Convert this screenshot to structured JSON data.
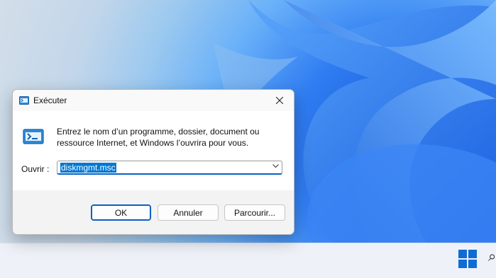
{
  "dialog": {
    "title": "Exécuter",
    "description": "Entrez le nom d’un programme, dossier, document ou ressource Internet, et Windows l’ouvrira pour vous.",
    "open_label": "Ouvrir :",
    "open_value": "diskmgmt.msc",
    "ok_label": "OK",
    "cancel_label": "Annuler",
    "browse_label": "Parcourir..."
  },
  "icons": {
    "title": "run-icon",
    "large": "run-icon",
    "close": "close-icon",
    "dropdown": "chevron-down-icon",
    "start": "windows-logo-icon",
    "search": "search-icon"
  },
  "colors": {
    "accent": "#0078d4",
    "wallpaper_blue": "#2f7df2"
  }
}
